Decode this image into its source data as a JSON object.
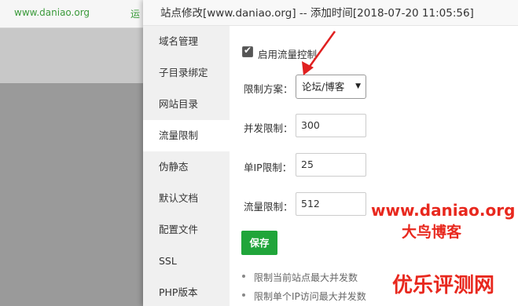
{
  "background": {
    "url_text": "www.daniao.org",
    "partial_label": "运"
  },
  "modal": {
    "title": "站点修改[www.daniao.org] -- 添加时间[2018-07-20 11:05:56]"
  },
  "sidebar": {
    "items": [
      {
        "label": "域名管理",
        "active": false
      },
      {
        "label": "子目录绑定",
        "active": false
      },
      {
        "label": "网站目录",
        "active": false
      },
      {
        "label": "流量限制",
        "active": true
      },
      {
        "label": "伪静态",
        "active": false
      },
      {
        "label": "默认文档",
        "active": false
      },
      {
        "label": "配置文件",
        "active": false
      },
      {
        "label": "SSL",
        "active": false
      },
      {
        "label": "PHP版本",
        "active": false
      }
    ]
  },
  "form": {
    "enable_label": "启用流量控制",
    "enable_checked": true,
    "scheme_label": "限制方案：",
    "scheme_value": "论坛/博客",
    "concurrency_label": "并发限制：",
    "concurrency_value": "300",
    "per_ip_label": "单IP限制：",
    "per_ip_value": "25",
    "traffic_label": "流量限制：",
    "traffic_value": "512",
    "save_label": "保存"
  },
  "tips": [
    "限制当前站点最大并发数",
    "限制单个IP访问最大并发数"
  ],
  "watermarks": {
    "site": "www.daniao.org",
    "blog_name": "大鸟博客",
    "review_name": "优乐评测网"
  },
  "colors": {
    "accent_green": "#20a53a",
    "watermark_red": "#e8281e",
    "arrow_red": "#e02020"
  },
  "icons": {
    "checkbox": "checkmark-icon",
    "select_caret": "caret-down-icon",
    "annotation": "red-arrow-icon"
  }
}
